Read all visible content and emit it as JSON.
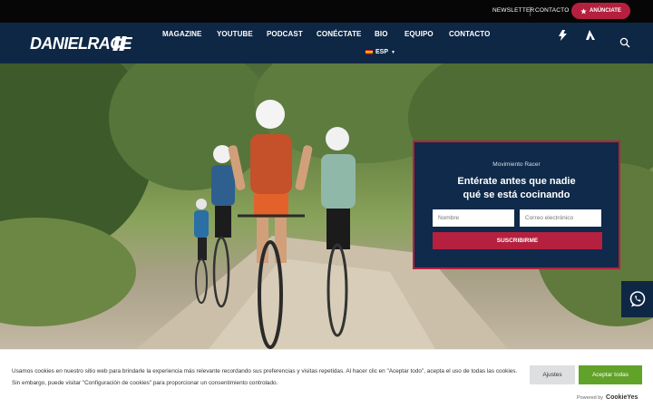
{
  "topbar": {
    "links": [
      "NEWSLETTER",
      "CONTACTO"
    ],
    "announce_label": "ANÚNCIATE",
    "announce_icon": "star-icon"
  },
  "nav": {
    "logo_text": "DANIELRACE",
    "items": [
      "MAGAZINE",
      "YOUTUBE",
      "PODCAST",
      "CONÉCTATE",
      "BIO",
      "EQUIPO",
      "CONTACTO"
    ],
    "language": "ESP",
    "icons": [
      "strava-icon",
      "activity-icon",
      "search-icon"
    ]
  },
  "newsletter": {
    "kicker": "Movimiento Racer",
    "title_line1": "Entérate antes que nadie",
    "title_line2": "qué se está cocinando",
    "name_placeholder": "Nombre",
    "email_placeholder": "Correo electrónico",
    "submit_label": "SUSCRIBIRME"
  },
  "floating": {
    "icon": "whatsapp-icon"
  },
  "cookie": {
    "text": "Usamos cookies en nuestro sitio web para brindarle la experiencia más relevante recordando sus preferencias y visitas repetidas. Al hacer clic en \"Aceptar todo\", acepta el uso de todas las cookies. Sin embargo, puede visitar \"Configuración de cookies\" para proporcionar un consentimiento controlado.",
    "settings_label": "Ajustes",
    "accept_label": "Aceptar todas",
    "powered_prefix": "Powered by",
    "powered_brand": "CookieYes"
  },
  "colors": {
    "navy": "#0e2745",
    "crimson": "#b5203f",
    "accept_green": "#61a229"
  }
}
